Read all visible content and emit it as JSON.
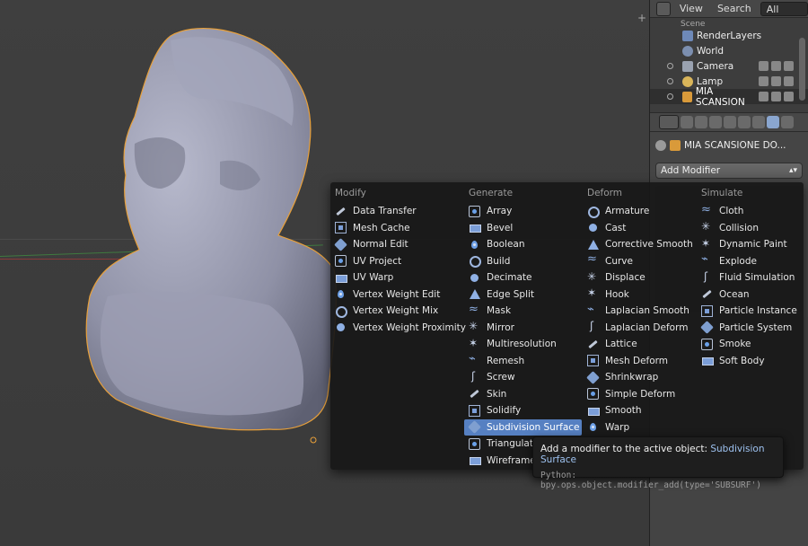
{
  "outliner": {
    "header": {
      "view": "View",
      "search": "Search",
      "scenes": "All Scenes"
    },
    "partial_top": "Scene",
    "items": [
      {
        "label": "RenderLayers",
        "icon": "render-layers-icon"
      },
      {
        "label": "World",
        "icon": "world-icon"
      },
      {
        "label": "Camera",
        "icon": "camera-icon"
      },
      {
        "label": "Lamp",
        "icon": "lamp-icon"
      },
      {
        "label": "MIA SCANSION",
        "icon": "mesh-icon"
      }
    ]
  },
  "properties": {
    "object_name": "MIA SCANSIONE DO...",
    "add_modifier": "Add Modifier"
  },
  "menu": {
    "columns": [
      {
        "title": "Modify",
        "items": [
          "Data Transfer",
          "Mesh Cache",
          "Normal Edit",
          "UV Project",
          "UV Warp",
          "Vertex Weight Edit",
          "Vertex Weight Mix",
          "Vertex Weight Proximity"
        ]
      },
      {
        "title": "Generate",
        "items": [
          "Array",
          "Bevel",
          "Boolean",
          "Build",
          "Decimate",
          "Edge Split",
          "Mask",
          "Mirror",
          "Multiresolution",
          "Remesh",
          "Screw",
          "Skin",
          "Solidify",
          "Subdivision Surface",
          "Triangulate",
          "Wireframe"
        ]
      },
      {
        "title": "Deform",
        "items": [
          "Armature",
          "Cast",
          "Corrective Smooth",
          "Curve",
          "Displace",
          "Hook",
          "Laplacian Smooth",
          "Laplacian Deform",
          "Lattice",
          "Mesh Deform",
          "Shrinkwrap",
          "Simple Deform",
          "Smooth",
          "Warp"
        ]
      },
      {
        "title": "Simulate",
        "items": [
          "Cloth",
          "Collision",
          "Dynamic Paint",
          "Explode",
          "Fluid Simulation",
          "Ocean",
          "Particle Instance",
          "Particle System",
          "Smoke",
          "Soft Body"
        ]
      }
    ],
    "highlighted": "Subdivision Surface"
  },
  "tooltip": {
    "prefix": "Add a modifier to the active object:",
    "value": "Subdivision Surface",
    "python": "Python: bpy.ops.object.modifier_add(type='SUBSURF')"
  },
  "colors": {
    "highlight": "#5680c2",
    "selection_outline": "#e8a03a",
    "mesh": "#9a9cb2"
  }
}
